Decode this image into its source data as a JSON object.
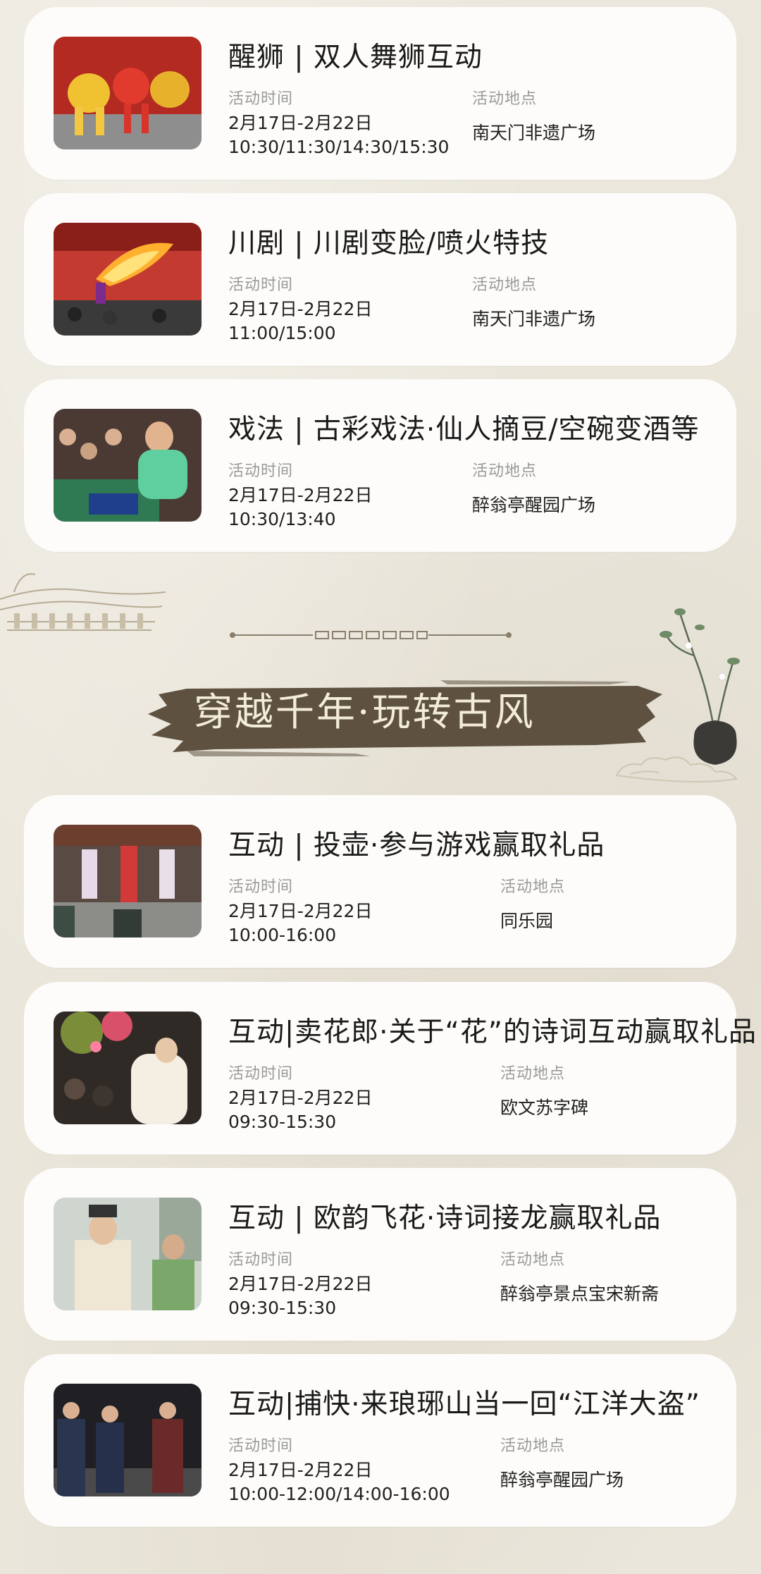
{
  "section_banner": "穿越千年·玩转古风",
  "time_label": "活动时间",
  "location_label": "活动地点",
  "activities": [
    {
      "title": "醒狮 | 双人舞狮互动",
      "date": "2月17日-2月22日",
      "hours": "10:30/11:30/14:30/15:30",
      "location": "南天门非遗广场",
      "image": "lion-dance-photo"
    },
    {
      "title": "川剧 | 川剧变脸/喷火特技",
      "date": "2月17日-2月22日",
      "hours": "11:00/15:00",
      "location": "南天门非遗广场",
      "image": "sichuan-opera-fire-photo"
    },
    {
      "title": "戏法 | 古彩戏法·仙人摘豆/空碗变酒等",
      "date": "2月17日-2月22日",
      "hours": "10:30/13:40",
      "location": "醉翁亭醒园广场",
      "image": "magic-show-photo"
    },
    {
      "title": "互动 | 投壶·参与游戏赢取礼品",
      "date": "2月17日-2月22日",
      "hours": "10:00-16:00",
      "location": "同乐园",
      "image": "touhu-game-photo"
    },
    {
      "title": "互动|卖花郎·关于“花”的诗词互动赢取礼品",
      "date": "2月17日-2月22日",
      "hours": "09:30-15:30",
      "location": "欧文苏字碑",
      "image": "flower-seller-photo"
    },
    {
      "title": "互动 | 欧韵飞花·诗词接龙赢取礼品",
      "date": "2月17日-2月22日",
      "hours": "09:30-15:30",
      "location": "醉翁亭景点宝宋新斋",
      "image": "poetry-relay-photo"
    },
    {
      "title": "互动|捕快·来琅琊山当一回“江洋大盗”",
      "date": "2月17日-2月22日",
      "hours": "10:00-12:00/14:00-16:00",
      "location": "醉翁亭醒园广场",
      "image": "constable-roleplay-photo"
    }
  ],
  "colors": {
    "background": "#ebe7dc",
    "card": "#fdfcfa",
    "banner_ink": "#5e5140",
    "banner_text": "#f3ecd9",
    "label_gray": "#9a9a9a"
  }
}
